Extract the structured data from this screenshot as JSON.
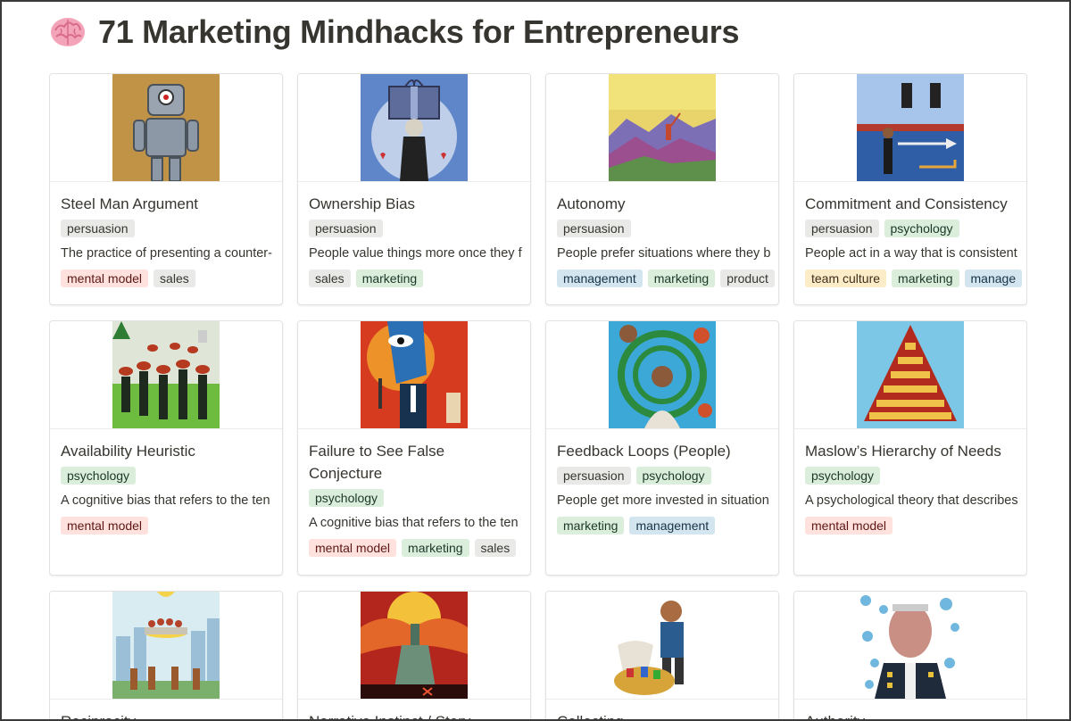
{
  "page": {
    "icon": "brain-emoji",
    "title": "71 Marketing Mindhacks for Entrepreneurs"
  },
  "tag_colors": {
    "persuasion": "#e9e9e7",
    "psychology": "#dbeddb",
    "mental model": "#ffe2dd",
    "sales": "#e9e9e7",
    "marketing": "#dbeddb",
    "management": "#d3e5ef",
    "product": "#e9e9e7",
    "team culture": "#fdecc8"
  },
  "cards": [
    {
      "title": "Steel Man Argument",
      "cover": "robot",
      "category": [
        "persuasion"
      ],
      "description": "The practice of presenting a counter-",
      "tags": [
        "mental model",
        "sales"
      ]
    },
    {
      "title": "Ownership Bias",
      "cover": "gift",
      "category": [
        "persuasion"
      ],
      "description": "People value things more once they f",
      "tags": [
        "sales",
        "marketing"
      ]
    },
    {
      "title": "Autonomy",
      "cover": "mountain",
      "category": [
        "persuasion"
      ],
      "description": "People prefer situations where they b",
      "tags": [
        "management",
        "marketing",
        "product"
      ]
    },
    {
      "title": "Commitment and Consistency",
      "cover": "figures",
      "category": [
        "persuasion",
        "psychology"
      ],
      "description": "People act in a way that is consistent",
      "tags": [
        "team culture",
        "marketing",
        "manage"
      ]
    },
    {
      "title": "Availability Heuristic",
      "cover": "crowd",
      "category": [
        "psychology"
      ],
      "description": "A cognitive bias that refers to the ten",
      "tags": [
        "mental model"
      ]
    },
    {
      "title": "Failure to See False Conjecture",
      "cover": "eye-head",
      "category": [
        "psychology"
      ],
      "description": "A cognitive bias that refers to the ten",
      "tags": [
        "mental model",
        "marketing",
        "sales"
      ]
    },
    {
      "title": "Feedback Loops (People)",
      "cover": "loops",
      "category": [
        "persuasion",
        "psychology"
      ],
      "description": "People get more invested in situation",
      "tags": [
        "marketing",
        "management"
      ]
    },
    {
      "title": "Maslow’s Hierarchy of Needs",
      "cover": "pyramid",
      "category": [
        "psychology"
      ],
      "description": "A psychological theory that describes",
      "tags": [
        "mental model"
      ]
    },
    {
      "title": "Reciprocity",
      "cover": "city",
      "category": [],
      "description": "",
      "tags": []
    },
    {
      "title": "Narrative Instinct / Story",
      "cover": "fire",
      "category": [],
      "description": "",
      "tags": []
    },
    {
      "title": "Collecting",
      "cover": "boy",
      "category": [],
      "description": "",
      "tags": []
    },
    {
      "title": "Authority",
      "cover": "officer",
      "category": [],
      "description": "",
      "tags": []
    }
  ]
}
